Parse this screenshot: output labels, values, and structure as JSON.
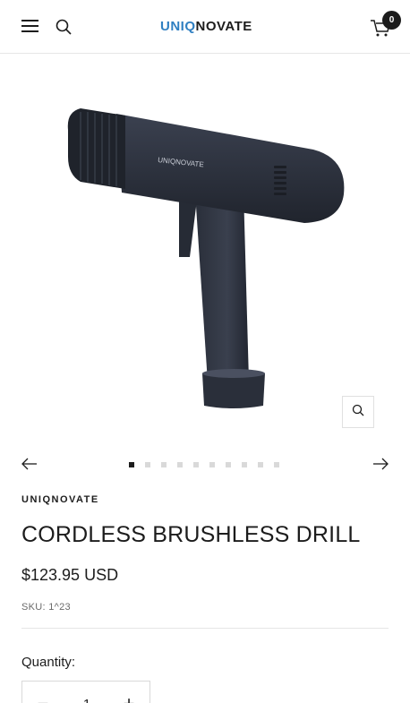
{
  "header": {
    "logo_part1": "UNIQ",
    "logo_part2": "NOVATE",
    "cart_count": "0",
    "icons": {
      "menu": "hamburger-icon",
      "search": "search-icon",
      "cart": "cart-icon"
    }
  },
  "gallery": {
    "image": "cordless-drill-product-image",
    "image_logo": "UNIQNOVATE",
    "zoom_icon": "zoom-icon",
    "prev_icon": "arrow-left-icon",
    "next_icon": "arrow-right-icon",
    "slide_count": 10,
    "active_slide": 1
  },
  "product": {
    "vendor": "UNIQNOVATE",
    "title": "CORDLESS BRUSHLESS DRILL",
    "price": "$123.95 USD",
    "sku": "SKU: 1^23",
    "quantity_label": "Quantity:",
    "quantity_value": "1",
    "minus_label": "−",
    "plus_label": "+"
  },
  "colors": {
    "text": "#1c1c1c",
    "accent": "#2f7fc1",
    "drill_body": "#2b303b"
  }
}
